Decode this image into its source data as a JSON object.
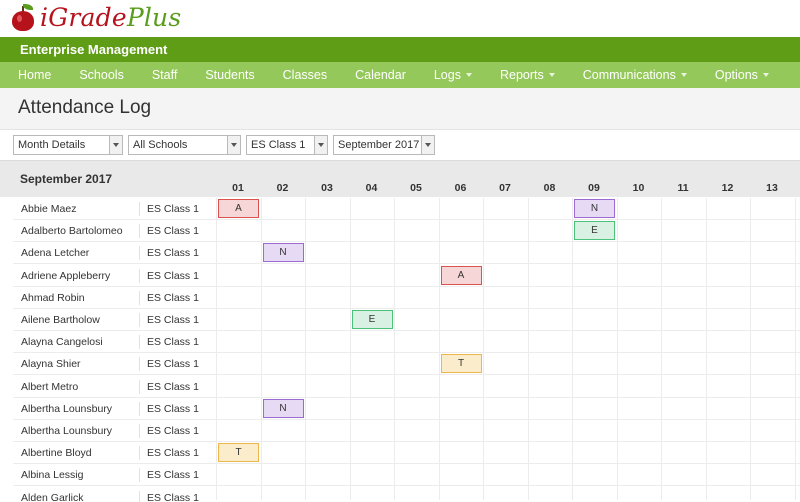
{
  "app": {
    "logo_i": "i",
    "logo_grade": "Grade",
    "logo_plus": "Plus",
    "section": "Enterprise Management"
  },
  "nav": [
    {
      "label": "Home",
      "dropdown": false
    },
    {
      "label": "Schools",
      "dropdown": false
    },
    {
      "label": "Staff",
      "dropdown": false
    },
    {
      "label": "Students",
      "dropdown": false
    },
    {
      "label": "Classes",
      "dropdown": false
    },
    {
      "label": "Calendar",
      "dropdown": false
    },
    {
      "label": "Logs",
      "dropdown": true
    },
    {
      "label": "Reports",
      "dropdown": true
    },
    {
      "label": "Communications",
      "dropdown": true
    },
    {
      "label": "Options",
      "dropdown": true
    }
  ],
  "page": {
    "title": "Attendance Log"
  },
  "filters": {
    "view": "Month Details",
    "school": "All Schools",
    "class": "ES Class 1",
    "month": "September 2017"
  },
  "grid": {
    "month_label": "September 2017",
    "days": [
      "01",
      "02",
      "03",
      "04",
      "05",
      "06",
      "07",
      "08",
      "09",
      "10",
      "11",
      "12",
      "13"
    ],
    "rows": [
      {
        "name": "Abbie Maez",
        "class": "ES Class 1",
        "marks": [
          {
            "day": 1,
            "code": "A"
          },
          {
            "day": 9,
            "code": "N"
          }
        ]
      },
      {
        "name": "Adalberto Bartolomeo",
        "class": "ES Class 1",
        "marks": [
          {
            "day": 9,
            "code": "E"
          }
        ]
      },
      {
        "name": "Adena Letcher",
        "class": "ES Class 1",
        "marks": [
          {
            "day": 2,
            "code": "N"
          }
        ]
      },
      {
        "name": "Adriene Appleberry",
        "class": "ES Class 1",
        "marks": [
          {
            "day": 6,
            "code": "A"
          }
        ]
      },
      {
        "name": "Ahmad Robin",
        "class": "ES Class 1",
        "marks": []
      },
      {
        "name": "Ailene Bartholow",
        "class": "ES Class 1",
        "marks": [
          {
            "day": 4,
            "code": "E"
          }
        ]
      },
      {
        "name": "Alayna Cangelosi",
        "class": "ES Class 1",
        "marks": []
      },
      {
        "name": "Alayna Shier",
        "class": "ES Class 1",
        "marks": [
          {
            "day": 6,
            "code": "T"
          }
        ]
      },
      {
        "name": "Albert Metro",
        "class": "ES Class 1",
        "marks": []
      },
      {
        "name": "Albertha Lounsbury",
        "class": "ES Class 1",
        "marks": [
          {
            "day": 2,
            "code": "N"
          }
        ]
      },
      {
        "name": "Albertha Lounsbury",
        "class": "ES Class 1",
        "marks": []
      },
      {
        "name": "Albertine Bloyd",
        "class": "ES Class 1",
        "marks": [
          {
            "day": 1,
            "code": "T"
          }
        ]
      },
      {
        "name": "Albina Lessig",
        "class": "ES Class 1",
        "marks": []
      },
      {
        "name": "Alden Garlick",
        "class": "ES Class 1",
        "marks": []
      }
    ]
  },
  "colors": {
    "brand_green": "#5e9d15",
    "nav_green": "#95c85a",
    "brand_red": "#b5121b"
  }
}
